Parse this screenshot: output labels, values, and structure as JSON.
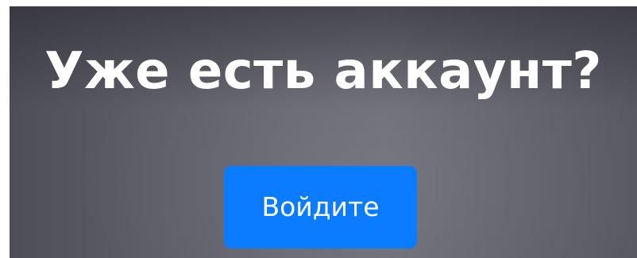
{
  "cta": {
    "heading": "Уже есть аккаунт?",
    "button_label": "Войдите"
  },
  "colors": {
    "button_background": "#0b7bff",
    "text": "#ffffff"
  }
}
